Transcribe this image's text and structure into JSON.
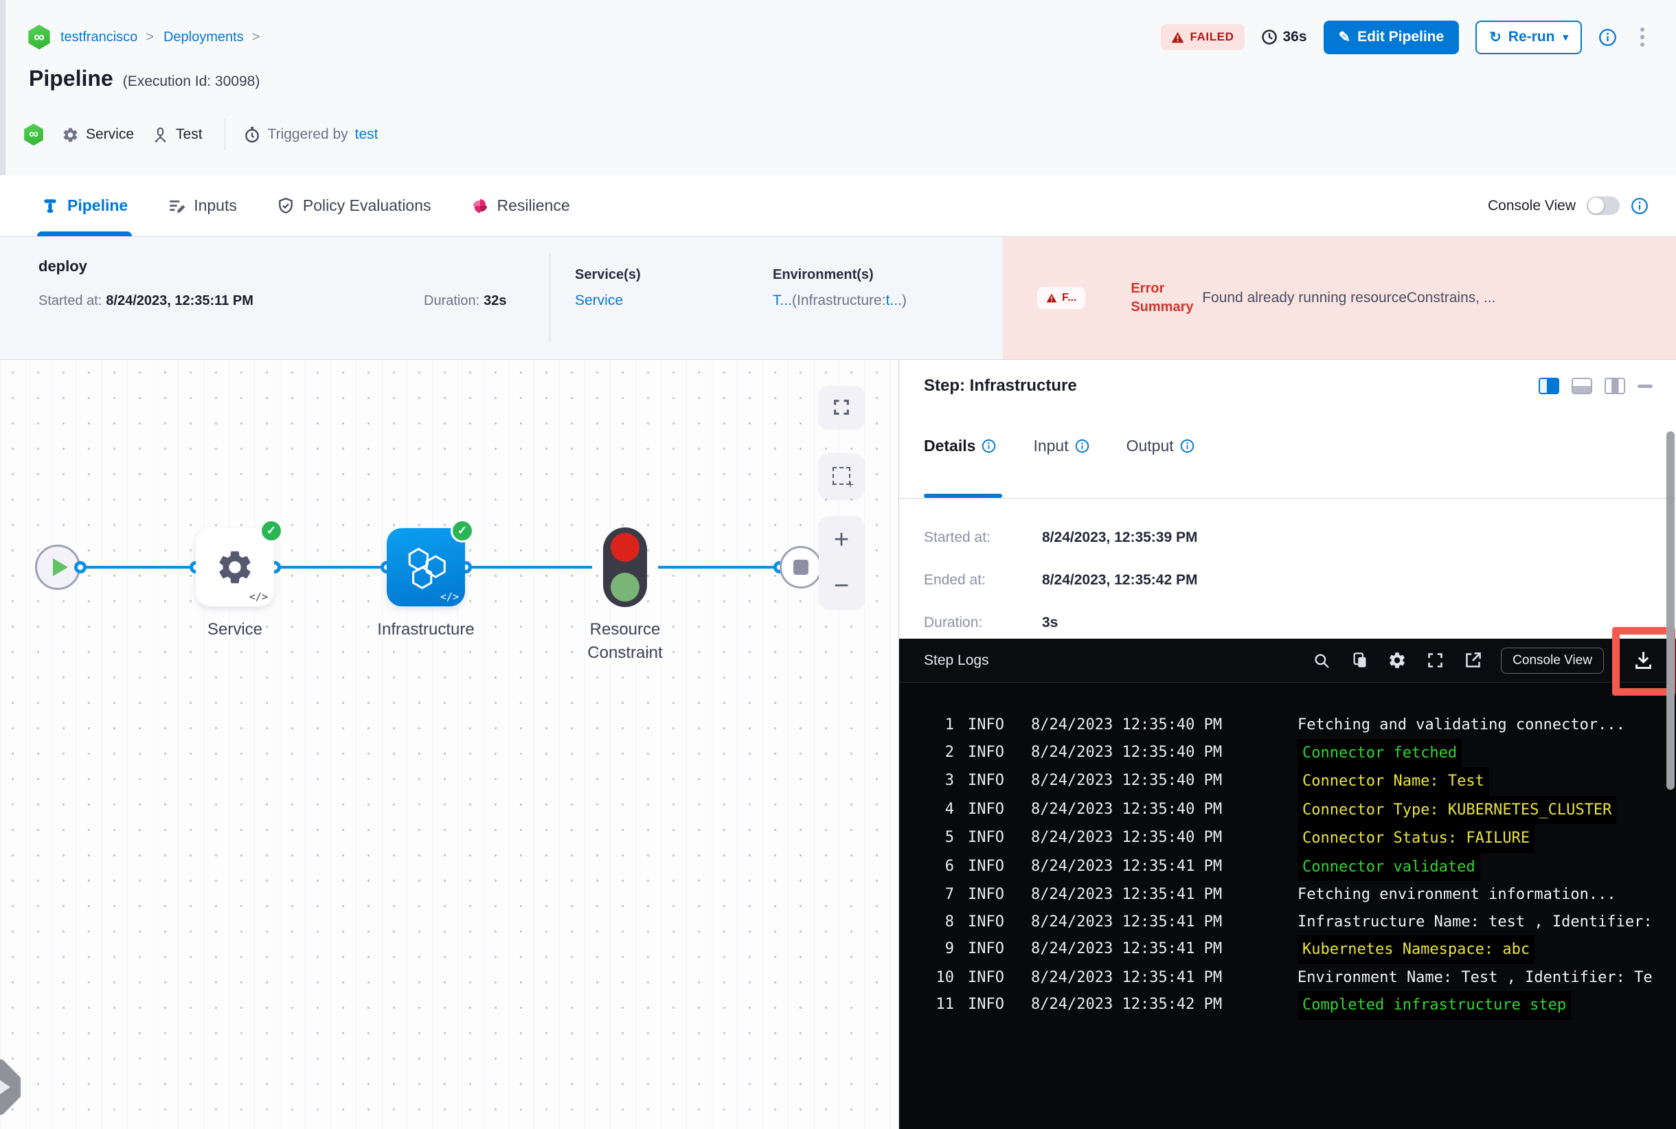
{
  "colors": {
    "accent_blue": "#0278d5",
    "failed_red": "#b41710",
    "error_bg": "#fae4e1",
    "success_green": "#2bb656",
    "node_blue_start": "#0b9ff0",
    "node_blue_end": "#0177d1",
    "log_green": "#35d435",
    "log_yellow": "#e9e43e",
    "log_white": "#f2f2f2",
    "highlight_red": "#f55a4e"
  },
  "glyphs": {
    "chevron": ">",
    "check": "✓",
    "code": "</>",
    "plus": "+",
    "minus": "−",
    "caret": "▾",
    "pencil": "✎",
    "refresh": "↻",
    "infinity": "∞"
  },
  "icon_names": [
    "harness-logo",
    "warning-triangle-icon",
    "clock-icon",
    "edit-pencil-icon",
    "rerun-refresh-icon",
    "info-icon",
    "kebab-menu-icon",
    "gear-icon",
    "test-rig-icon",
    "stopwatch-icon",
    "pipeline-icon",
    "inputs-icon",
    "policy-shield-icon",
    "resilience-icon",
    "console-toggle",
    "fullscreen-icon",
    "marquee-select-icon",
    "zoom-in-icon",
    "zoom-out-icon",
    "layout-right-icon",
    "layout-bottom-icon",
    "layout-float-icon",
    "minimize-icon",
    "search-icon",
    "copy-icon",
    "settings-gear-icon",
    "expand-icon",
    "external-link-icon",
    "download-icon"
  ],
  "header": {
    "breadcrumb": {
      "items": [
        "testfrancisco",
        "Deployments"
      ]
    },
    "status": "FAILED",
    "elapsed": "36s",
    "edit_pipeline": "Edit Pipeline",
    "rerun": "Re-run",
    "title": "Pipeline",
    "execution_id": "(Execution Id: 30098)",
    "meta": {
      "service": "Service",
      "test": "Test",
      "triggered_by": "Triggered by",
      "trigger_user": "test"
    }
  },
  "tabbar": {
    "tabs": [
      "Pipeline",
      "Inputs",
      "Policy Evaluations",
      "Resilience"
    ],
    "console_view": "Console View"
  },
  "summary": {
    "stage_name": "deploy",
    "started_label": "Started at:",
    "started_value": "8/24/2023, 12:35:11 PM",
    "duration_label": "Duration:",
    "duration_value": "32s",
    "services_label": "Service(s)",
    "services_value": "Service",
    "environments_label": "Environment(s)",
    "env_parts": {
      "a": "T...",
      "b": "(Infrastructure:",
      "c": "t...",
      "d": ")"
    },
    "error_badge": "F...",
    "error_label_line1": "Error",
    "error_label_line2": "Summary",
    "error_text": "Found already running resourceConstrains, ..."
  },
  "graph": {
    "node_labels": [
      "Service",
      "Infrastructure",
      "Resource Constraint"
    ]
  },
  "panel": {
    "title": "Step: Infrastructure",
    "tabs": [
      "Details",
      "Input",
      "Output"
    ],
    "details": [
      {
        "label": "Started at:",
        "value": "8/24/2023, 12:35:39 PM"
      },
      {
        "label": "Ended at:",
        "value": "8/24/2023, 12:35:42 PM"
      },
      {
        "label": "Duration:",
        "value": "3s"
      }
    ],
    "logs": {
      "title": "Step Logs",
      "console_view": "Console View",
      "lines": [
        {
          "n": "1",
          "level": "INFO",
          "time": "8/24/2023 12:35:40 PM",
          "msg": "Fetching and validating connector...",
          "color": "white"
        },
        {
          "n": "2",
          "level": "INFO",
          "time": "8/24/2023 12:35:40 PM",
          "msg": "Connector fetched",
          "color": "green"
        },
        {
          "n": "3",
          "level": "INFO",
          "time": "8/24/2023 12:35:40 PM",
          "msg": "Connector Name: Test",
          "color": "yellow"
        },
        {
          "n": "4",
          "level": "INFO",
          "time": "8/24/2023 12:35:40 PM",
          "msg": "Connector Type: KUBERNETES_CLUSTER",
          "color": "yellow"
        },
        {
          "n": "5",
          "level": "INFO",
          "time": "8/24/2023 12:35:40 PM",
          "msg": "Connector Status: FAILURE",
          "color": "yellow"
        },
        {
          "n": "6",
          "level": "INFO",
          "time": "8/24/2023 12:35:41 PM",
          "msg": "Connector validated",
          "color": "green"
        },
        {
          "n": "7",
          "level": "INFO",
          "time": "8/24/2023 12:35:41 PM",
          "msg": "Fetching environment information...",
          "color": "white"
        },
        {
          "n": "8",
          "level": "INFO",
          "time": "8/24/2023 12:35:41 PM",
          "msg": "Infrastructure Name: test , Identifier:",
          "color": "white"
        },
        {
          "n": "9",
          "level": "INFO",
          "time": "8/24/2023 12:35:41 PM",
          "msg": "Kubernetes Namespace: abc",
          "color": "yellow"
        },
        {
          "n": "10",
          "level": "INFO",
          "time": "8/24/2023 12:35:41 PM",
          "msg": "Environment Name: Test , Identifier: Te",
          "color": "white"
        },
        {
          "n": "11",
          "level": "INFO",
          "time": "8/24/2023 12:35:42 PM",
          "msg": "Completed infrastructure step",
          "color": "green"
        }
      ]
    }
  }
}
